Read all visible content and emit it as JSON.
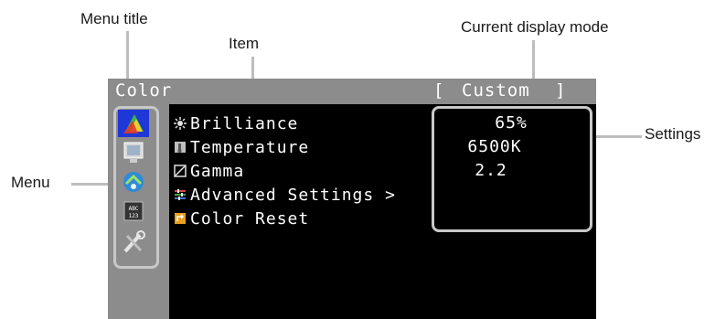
{
  "callouts": {
    "menu_title": "Menu title",
    "item": "Item",
    "current_mode": "Current display mode",
    "settings": "Settings",
    "menu": "Menu"
  },
  "osd": {
    "title": "Color",
    "mode_open": "[",
    "mode": "Custom",
    "mode_close": "]",
    "menu_icons": [
      "color-icon",
      "screen-icon",
      "signal-icon",
      "preference-icon",
      "tools-icon"
    ],
    "items": [
      {
        "label": "Brilliance",
        "icon": "brilliance-icon",
        "value": "65%"
      },
      {
        "label": "Temperature",
        "icon": "temperature-icon",
        "value": "6500K"
      },
      {
        "label": "Gamma",
        "icon": "gamma-icon",
        "value": "2.2"
      },
      {
        "label": "Advanced Settings >",
        "icon": "advanced-settings-icon",
        "value": ""
      },
      {
        "label": "Color Reset",
        "icon": "color-reset-icon",
        "value": ""
      }
    ]
  },
  "colors": {
    "osd_bg": "#000000",
    "bar": "#8c8c8c",
    "selected": "#1f37d6",
    "frame": "#c8c8c8"
  }
}
